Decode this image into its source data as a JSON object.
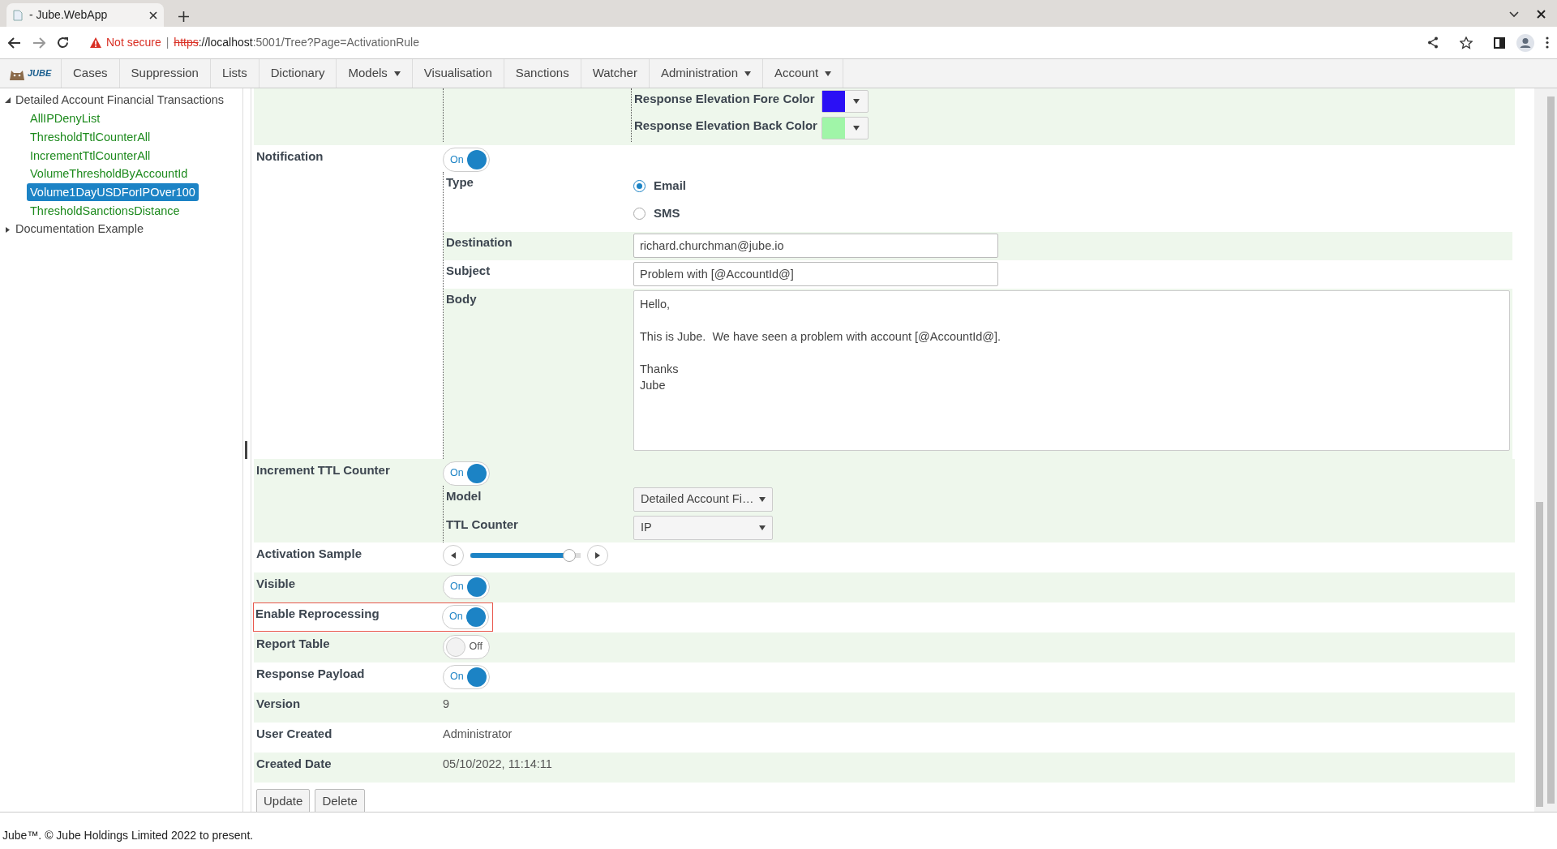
{
  "browser": {
    "tab_title": "- Jube.WebApp",
    "security_label": "Not secure",
    "separator": "|",
    "url": {
      "scheme": "https",
      "host": "://localhost",
      "path": ":5001/Tree?Page=ActivationRule"
    }
  },
  "logo_text": "JUBE",
  "nav": [
    {
      "label": "Cases",
      "dropdown": false
    },
    {
      "label": "Suppression",
      "dropdown": false
    },
    {
      "label": "Lists",
      "dropdown": false
    },
    {
      "label": "Dictionary",
      "dropdown": false
    },
    {
      "label": "Models",
      "dropdown": true
    },
    {
      "label": "Visualisation",
      "dropdown": false
    },
    {
      "label": "Sanctions",
      "dropdown": false
    },
    {
      "label": "Watcher",
      "dropdown": false
    },
    {
      "label": "Administration",
      "dropdown": true
    },
    {
      "label": "Account",
      "dropdown": true
    }
  ],
  "tree": [
    {
      "label": "Detailed Account Financial Transactions",
      "expanded": true,
      "children": [
        {
          "label": "AllIPDenyList",
          "selected": false
        },
        {
          "label": "ThresholdTtlCounterAll",
          "selected": false
        },
        {
          "label": "IncrementTtlCounterAll",
          "selected": false
        },
        {
          "label": "VolumeThresholdByAccountId",
          "selected": false
        },
        {
          "label": "Volume1DayUSDForIPOver100",
          "selected": true
        },
        {
          "label": "ThresholdSanctionsDistance",
          "selected": false
        }
      ]
    },
    {
      "label": "Documentation Example",
      "expanded": false
    }
  ],
  "form": {
    "rows": [
      {
        "kind": "group",
        "highlighted": false,
        "rows": [
          {
            "kind": "group",
            "rows": [
              {
                "kind": "color",
                "label": "Response Elevation Fore Color",
                "color": "#2b10f5"
              },
              {
                "kind": "color",
                "label": "Response Elevation Back Color",
                "color": "#a0f5a8"
              }
            ]
          }
        ]
      },
      {
        "kind": "toggle",
        "label": "Notification",
        "highlighted": false,
        "toggle": {
          "on": true,
          "text": "On"
        },
        "rows": [
          {
            "kind": "radio",
            "label": "Type",
            "options": [
              {
                "label": "Email",
                "selected": true
              },
              {
                "label": "SMS",
                "selected": false
              }
            ]
          },
          {
            "kind": "input",
            "label": "Destination",
            "value": "richard.churchman@jube.io"
          },
          {
            "kind": "input",
            "label": "Subject",
            "value": "Problem with [@AccountId@]"
          },
          {
            "kind": "textarea",
            "label": "Body",
            "value": "Hello,\n\nThis is Jube.  We have seen a problem with account [@AccountId@].\n\nThanks\nJube"
          }
        ]
      },
      {
        "kind": "toggle",
        "label": "Increment TTL Counter",
        "highlighted": false,
        "toggle": {
          "on": true,
          "text": "On"
        },
        "rows": [
          {
            "kind": "select",
            "label": "Model",
            "value": "Detailed Account Fi…"
          },
          {
            "kind": "select",
            "label": "TTL Counter",
            "value": "IP"
          }
        ]
      },
      {
        "kind": "slider",
        "label": "Activation Sample",
        "highlighted": false,
        "level": 0.95
      },
      {
        "kind": "toggle",
        "label": "Visible",
        "highlighted": false,
        "toggle": {
          "on": true,
          "text": "On"
        }
      },
      {
        "kind": "toggle",
        "label": "Enable Reprocessing",
        "highlighted": true,
        "toggle": {
          "on": true,
          "text": "On"
        }
      },
      {
        "kind": "toggle",
        "label": "Report Table",
        "highlighted": false,
        "toggle": {
          "on": false,
          "text": "Off"
        }
      },
      {
        "kind": "toggle",
        "label": "Response Payload",
        "highlighted": false,
        "toggle": {
          "on": true,
          "text": "On"
        }
      },
      {
        "kind": "text",
        "label": "Version",
        "highlighted": false,
        "value": "9"
      },
      {
        "kind": "text",
        "label": "User Created",
        "highlighted": false,
        "value": "Administrator"
      },
      {
        "kind": "text",
        "label": "Created Date",
        "highlighted": false,
        "value": "05/10/2022, 11:14:11"
      }
    ],
    "buttons": [
      "Update",
      "Delete"
    ]
  },
  "footer": "Jube™. © Jube Holdings Limited 2022 to present."
}
